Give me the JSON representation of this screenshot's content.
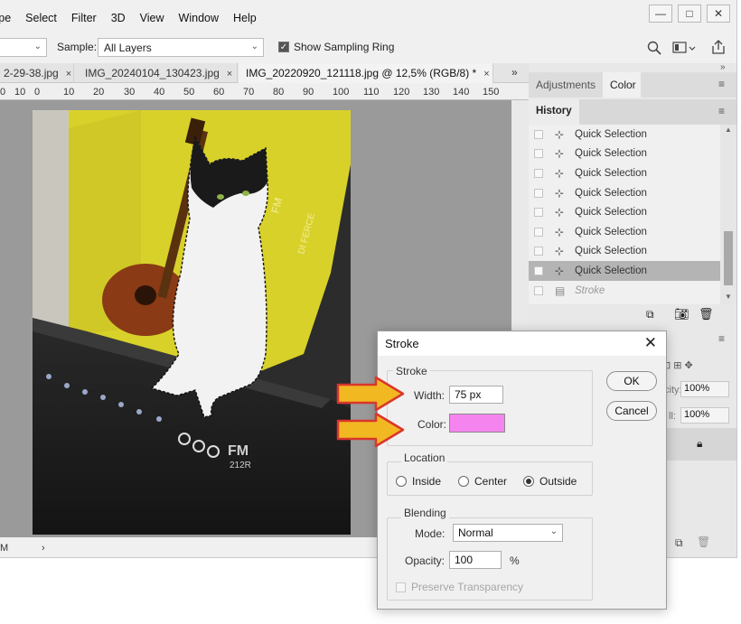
{
  "menu": [
    "ype",
    "Select",
    "Filter",
    "3D",
    "View",
    "Window",
    "Help"
  ],
  "window_buttons": [
    "—",
    "□",
    "✕"
  ],
  "options": {
    "first_dropdown_chevron": "⌄",
    "sample_label": "Sample:",
    "sample_value": "All Layers",
    "show_sampling_ring_label": "Show Sampling Ring",
    "show_sampling_ring_checked": true
  },
  "tabs": [
    {
      "label": "2-29-38.jpg",
      "close": "×"
    },
    {
      "label": "IMG_20240104_130423.jpg",
      "close": "×"
    },
    {
      "label": "IMG_20220920_121118.jpg @ 12,5% (RGB/8) *",
      "close": "×",
      "active": true
    }
  ],
  "tabs_overflow": "»",
  "ruler_ticks": [
    "0",
    "10",
    "0",
    "10",
    "20",
    "30",
    "40",
    "50",
    "60",
    "70",
    "80",
    "90",
    "100",
    "110",
    "120",
    "130",
    "140",
    "150"
  ],
  "status": {
    "zoom": "M",
    "arrow": "›"
  },
  "panels": {
    "tab_adjustments": "Adjustments",
    "tab_color": "Color",
    "history_title": "History",
    "history_items": [
      {
        "label": "Quick Selection",
        "state": "normal"
      },
      {
        "label": "Quick Selection",
        "state": "normal"
      },
      {
        "label": "Quick Selection",
        "state": "normal"
      },
      {
        "label": "Quick Selection",
        "state": "normal"
      },
      {
        "label": "Quick Selection",
        "state": "normal"
      },
      {
        "label": "Quick Selection",
        "state": "normal"
      },
      {
        "label": "Quick Selection",
        "state": "normal"
      },
      {
        "label": "Quick Selection",
        "state": "selected"
      },
      {
        "label": "Stroke",
        "state": "dimmed"
      }
    ],
    "layers_opacity": "100%",
    "layers_fill": "100%",
    "layers_opacity_label": "city:",
    "layers_fill_label": "ll:"
  },
  "dialog": {
    "title": "Stroke",
    "stroke_group": "Stroke",
    "width_label": "Width:",
    "width_value": "75 px",
    "color_label": "Color:",
    "color_value": "#f584ee",
    "ok": "OK",
    "cancel": "Cancel",
    "location_group": "Location",
    "location_options": [
      {
        "label": "Inside",
        "selected": false
      },
      {
        "label": "Center",
        "selected": false
      },
      {
        "label": "Outside",
        "selected": true
      }
    ],
    "blending_group": "Blending",
    "mode_label": "Mode:",
    "mode_value": "Normal",
    "opacity_label": "Opacity:",
    "opacity_value": "100",
    "opacity_unit": "%",
    "preserve_label": "Preserve Transparency"
  },
  "colors": {
    "annotation_arrow": "#f2b821",
    "arrow_outline": "#d9362c",
    "selection": "#b4b4b4"
  }
}
